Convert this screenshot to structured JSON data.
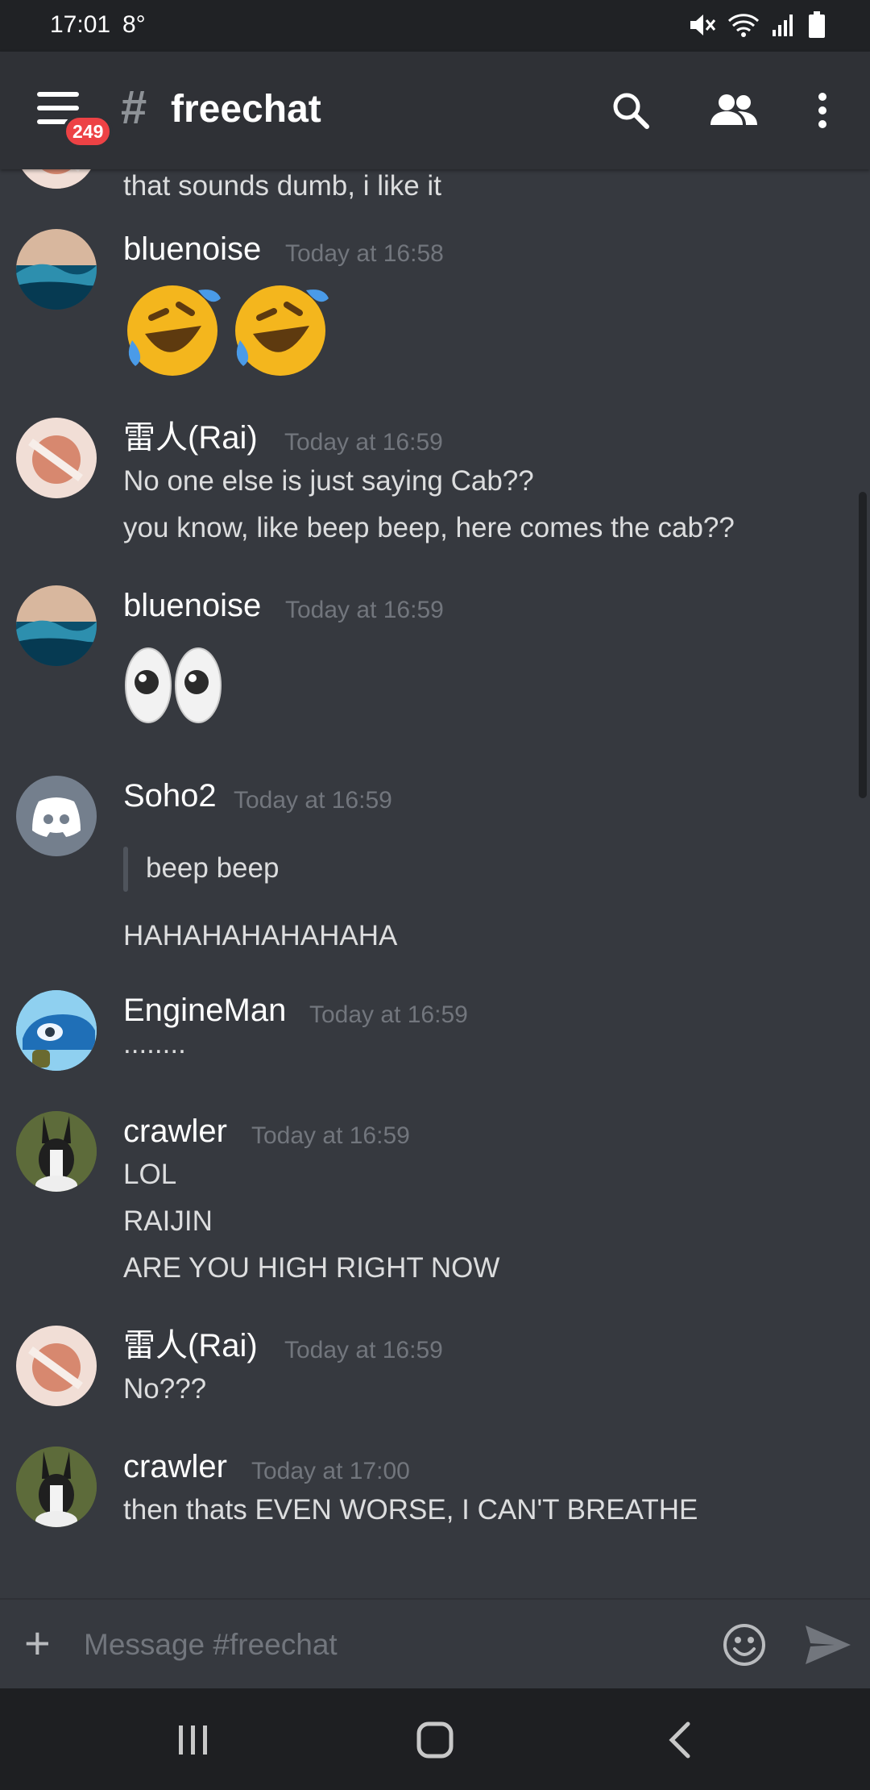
{
  "status_bar": {
    "time": "17:01",
    "temperature": "8°"
  },
  "header": {
    "channel_prefix": "#",
    "channel_name": "freechat",
    "badge_count": "249"
  },
  "messages": [
    {
      "author": "",
      "time": "",
      "avatar": "rai-avatar",
      "lines": [
        "that sounds dumb, i like it"
      ]
    },
    {
      "author": "bluenoise",
      "time": "Today at 16:58",
      "avatar": "wave-avatar",
      "emojis": [
        "rofl",
        "rofl"
      ]
    },
    {
      "author": "雷人(Rai)",
      "time": "Today at 16:59",
      "avatar": "rai-avatar",
      "lines": [
        "No one else is just saying Cab??",
        "you know, like beep beep, here comes the cab??"
      ]
    },
    {
      "author": "bluenoise",
      "time": "Today at 16:59",
      "avatar": "wave-avatar",
      "emojis": [
        "eyes"
      ]
    },
    {
      "author": "Soho2",
      "time": "Today at 16:59",
      "avatar": "discord-avatar",
      "quote": "beep beep",
      "lines": [
        "HAHAHAHAHAHAHA"
      ]
    },
    {
      "author": "EngineMan",
      "time": "Today at 16:59",
      "avatar": "car-avatar",
      "lines": [
        "........"
      ]
    },
    {
      "author": "crawler",
      "time": "Today at 16:59",
      "avatar": "rabbit-avatar",
      "lines": [
        "LOL",
        "RAIJIN",
        "ARE YOU HIGH RIGHT NOW"
      ]
    },
    {
      "author": "雷人(Rai)",
      "time": "Today at 16:59",
      "avatar": "rai-avatar",
      "lines": [
        "No???"
      ]
    },
    {
      "author": "crawler",
      "time": "Today at 17:00",
      "avatar": "rabbit-avatar",
      "lines": [
        "then thats EVEN WORSE, I CAN'T BREATHE"
      ]
    }
  ],
  "composer": {
    "placeholder": "Message #freechat"
  },
  "colors": {
    "background": "#36393f",
    "header": "#2f3136",
    "badge": "#ed4245",
    "muted": "#72767d"
  }
}
